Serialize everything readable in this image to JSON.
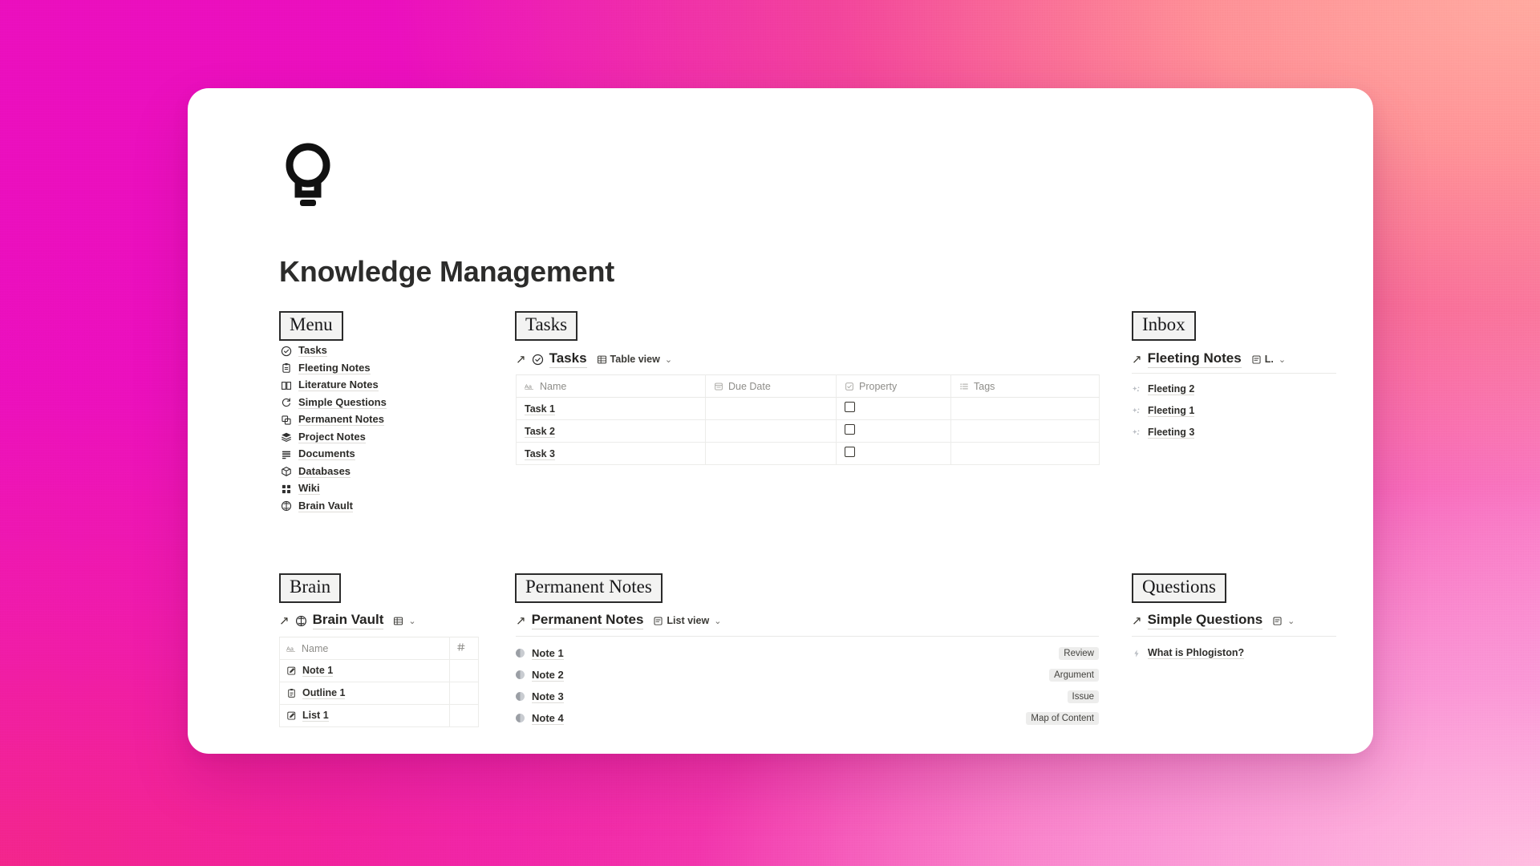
{
  "background": {
    "from": "#ee10be",
    "mid": "#f5359f",
    "to": "#ffb3d8",
    "accent_coral": "#ff9a95"
  },
  "page": {
    "icon": "lightbulb-icon",
    "title": "Knowledge Management"
  },
  "menu": {
    "heading": "Menu",
    "items": [
      {
        "label": "Tasks",
        "icon": "check-circle-icon"
      },
      {
        "label": "Fleeting Notes",
        "icon": "clipboard-icon"
      },
      {
        "label": "Literature Notes",
        "icon": "open-book-icon"
      },
      {
        "label": "Simple Questions",
        "icon": "refresh-icon"
      },
      {
        "label": "Permanent Notes",
        "icon": "copy-icon"
      },
      {
        "label": "Project Notes",
        "icon": "layers-icon"
      },
      {
        "label": "Documents",
        "icon": "documents-icon"
      },
      {
        "label": "Databases",
        "icon": "cube-icon"
      },
      {
        "label": "Wiki",
        "icon": "grid-icon"
      },
      {
        "label": "Brain Vault",
        "icon": "brain-circle-icon"
      }
    ]
  },
  "tasks": {
    "heading": "Tasks",
    "db_title": "Tasks",
    "db_icon": "check-circle-icon",
    "view_label": "Table view",
    "view_icon": "table-icon",
    "columns": [
      {
        "label": "Name",
        "icon": "text-aa-icon"
      },
      {
        "label": "Due Date",
        "icon": "date-icon"
      },
      {
        "label": "Property",
        "icon": "checkbox-icon"
      },
      {
        "label": "Tags",
        "icon": "multiselect-icon"
      }
    ],
    "rows": [
      {
        "name": "Task 1",
        "due_date": "",
        "property": false,
        "tags": ""
      },
      {
        "name": "Task 2",
        "due_date": "",
        "property": false,
        "tags": ""
      },
      {
        "name": "Task 3",
        "due_date": "",
        "property": false,
        "tags": ""
      }
    ]
  },
  "inbox": {
    "heading": "Inbox",
    "db_title": "Fleeting Notes",
    "view_label": "L.",
    "view_icon": "list-view-icon",
    "items": [
      {
        "label": "Fleeting 2",
        "icon": "sparkle-icon"
      },
      {
        "label": "Fleeting 1",
        "icon": "sparkle-icon"
      },
      {
        "label": "Fleeting 3",
        "icon": "sparkle-icon"
      }
    ]
  },
  "brain": {
    "heading": "Brain",
    "db_title": "Brain Vault",
    "db_icon": "brain-circle-icon",
    "view_icon": "table-icon",
    "columns": [
      {
        "label": "Name",
        "icon": "text-aa-icon"
      },
      {
        "label": "",
        "icon": "number-hash-icon"
      }
    ],
    "rows": [
      {
        "name": "Note 1",
        "icon": "note-pencil-icon"
      },
      {
        "name": "Outline 1",
        "icon": "clipboard-icon"
      },
      {
        "name": "List 1",
        "icon": "note-pencil-icon"
      }
    ]
  },
  "permanent_notes": {
    "heading": "Permanent Notes",
    "db_title": "Permanent Notes",
    "view_label": "List view",
    "view_icon": "list-view-icon",
    "items": [
      {
        "label": "Note 1",
        "tag": "Review",
        "icon": "half-circle-icon"
      },
      {
        "label": "Note 2",
        "tag": "Argument",
        "icon": "half-circle-icon"
      },
      {
        "label": "Note 3",
        "tag": "Issue",
        "icon": "half-circle-icon"
      },
      {
        "label": "Note 4",
        "tag": "Map of Content",
        "icon": "half-circle-icon"
      }
    ]
  },
  "questions": {
    "heading": "Questions",
    "db_title": "Simple Questions",
    "view_icon": "list-view-icon",
    "items": [
      {
        "label": "What is Phlogiston?",
        "icon": "spark-icon"
      }
    ]
  }
}
